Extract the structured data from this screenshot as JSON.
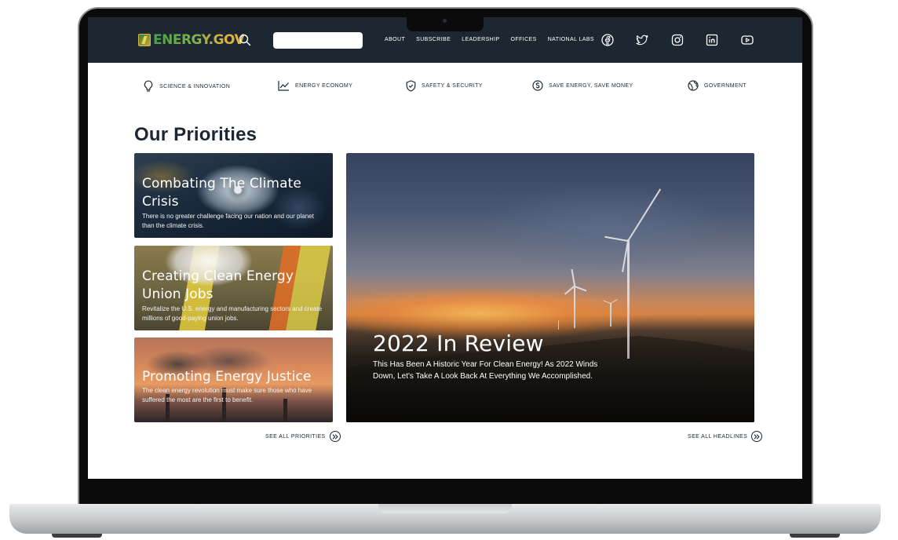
{
  "header": {
    "logo_text": "ENERGY.GOV",
    "search_placeholder": "",
    "nav": [
      "ABOUT",
      "SUBSCRIBE",
      "LEADERSHIP",
      "OFFICES",
      "NATIONAL LABS"
    ],
    "social": [
      "facebook-icon",
      "twitter-icon",
      "instagram-icon",
      "linkedin-icon",
      "youtube-icon"
    ]
  },
  "categories": [
    {
      "label": "SCIENCE & INNOVATION",
      "icon": "lightbulb-icon"
    },
    {
      "label": "ENERGY ECONOMY",
      "icon": "trend-chart-icon"
    },
    {
      "label": "SAFETY & SECURITY",
      "icon": "shield-icon"
    },
    {
      "label": "SAVE ENERGY, SAVE MONEY",
      "icon": "dollar-icon"
    },
    {
      "label": "GOVERNMENT",
      "icon": "globe-icon"
    }
  ],
  "main": {
    "title": "Our Priorities",
    "cards": [
      {
        "title": "Combating The Climate Crisis",
        "desc": "There is no greater challenge facing our nation and our planet than the climate crisis."
      },
      {
        "title": "Creating Clean Energy Union Jobs",
        "desc": "Revitalize the U.S. energy and manufacturing sectors and create millions of good-paying union jobs."
      },
      {
        "title": "Promoting Energy Justice",
        "desc": "The clean energy revolution must make sure those who have suffered the most are the first to benefit."
      }
    ],
    "hero": {
      "title": "2022 In Review",
      "desc": "This Has Been A Historic Year For Clean Energy! As 2022 Winds Down, Let's Take A Look Back At Everything We Accomplished."
    },
    "see_all_priorities": "SEE ALL PRIORITIES",
    "see_all_headlines": "SEE ALL HEADLINES"
  },
  "colors": {
    "topbar": "#1c2731",
    "text": "#1c2731",
    "logo_green": "#4aa14a",
    "logo_gold": "#d8b13c"
  }
}
